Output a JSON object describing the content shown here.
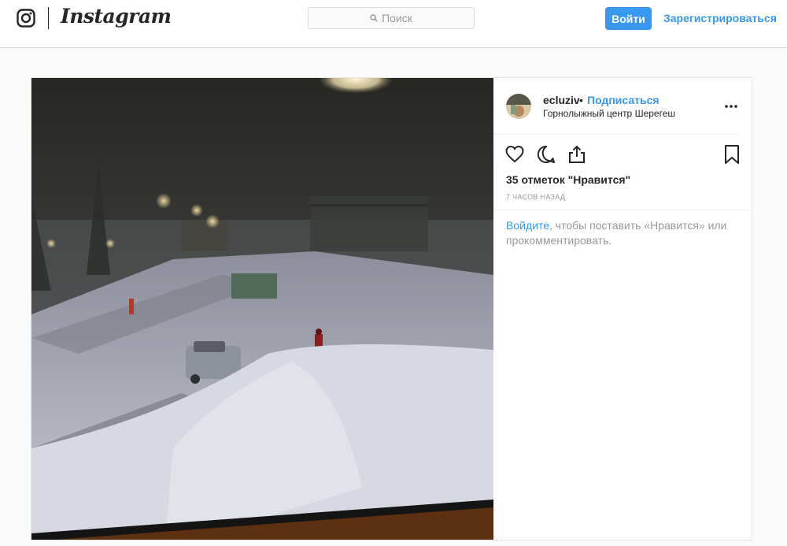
{
  "header": {
    "brand": "Instagram",
    "search_placeholder": "Поиск",
    "login_button": "Войти",
    "register_link": "Зарегистрироваться"
  },
  "post": {
    "username": "ecluziv",
    "separator": "•",
    "follow_label": "Подписаться",
    "location": "Горнолыжный центр Шерегеш",
    "likes": "35 отметок \"Нравится\"",
    "time_ago": "7 ЧАСОВ НАЗАД",
    "login_prompt_link": "Войдите",
    "login_prompt_text": ", чтобы поставить «Нравится» или прокомментировать."
  },
  "colors": {
    "accent": "#3897f0",
    "text": "#262626",
    "muted": "#999999",
    "border": "#dbdbdb"
  },
  "icons": [
    "instagram-glyph-icon",
    "search-icon",
    "more-options-icon",
    "heart-icon",
    "comment-icon",
    "share-icon",
    "bookmark-icon"
  ]
}
